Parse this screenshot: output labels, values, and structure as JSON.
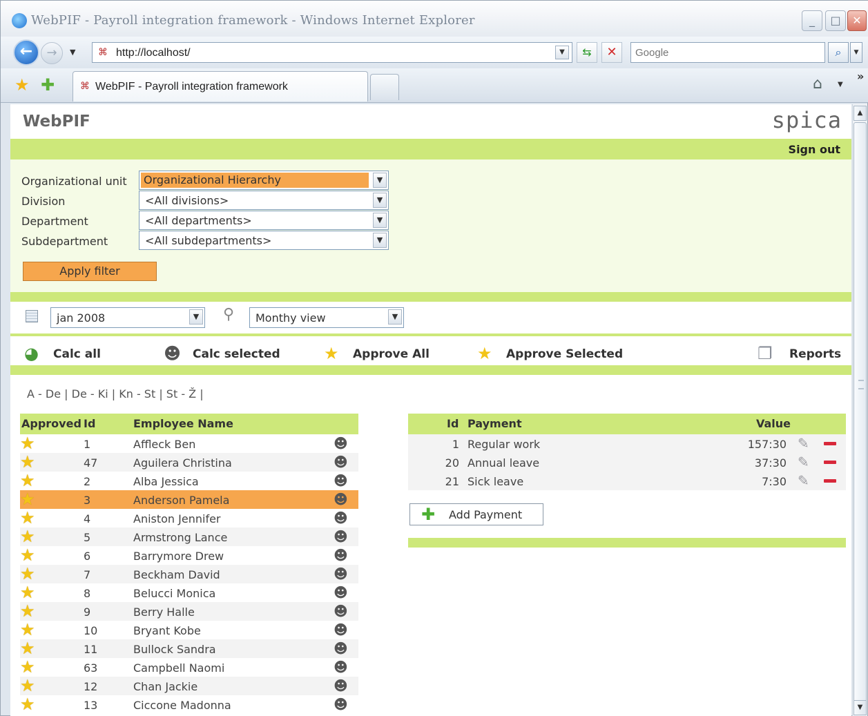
{
  "browser": {
    "window_title": "WebPIF - Payroll integration framework - Windows Internet Explorer",
    "address": "http://localhost/",
    "search_placeholder": "Google",
    "tab_title": "WebPIF - Payroll integration framework"
  },
  "app": {
    "brand": "WebPIF",
    "logo": "spica",
    "sign_out": "Sign out"
  },
  "filter": {
    "org_unit_label": "Organizational unit",
    "org_unit_value": "Organizational Hierarchy",
    "division_label": "Division",
    "division_value": "<All divisions>",
    "department_label": "Department",
    "department_value": "<All departments>",
    "subdepartment_label": "Subdepartment",
    "subdepartment_value": "<All subdepartments>",
    "apply_label": "Apply filter"
  },
  "period": {
    "month_value": "jan 2008",
    "view_value": "Monthy view"
  },
  "actions": {
    "calc_all": "Calc all",
    "calc_selected": "Calc selected",
    "approve_all": "Approve All",
    "approve_selected": "Approve Selected",
    "reports": "Reports"
  },
  "alpha_filter": "A - De | De - Ki | Kn - St | St - Ž |",
  "employees": {
    "headers": {
      "approved": "Approved",
      "id": "Id",
      "name": "Employee Name"
    },
    "selected_index": 3,
    "rows": [
      {
        "id": "1",
        "name": "Affleck Ben"
      },
      {
        "id": "47",
        "name": "Aguilera Christina"
      },
      {
        "id": "2",
        "name": "Alba Jessica"
      },
      {
        "id": "3",
        "name": "Anderson Pamela"
      },
      {
        "id": "4",
        "name": "Aniston Jennifer"
      },
      {
        "id": "5",
        "name": "Armstrong Lance"
      },
      {
        "id": "6",
        "name": "Barrymore Drew"
      },
      {
        "id": "7",
        "name": "Beckham David"
      },
      {
        "id": "8",
        "name": "Belucci Monica"
      },
      {
        "id": "9",
        "name": "Berry Halle"
      },
      {
        "id": "10",
        "name": "Bryant Kobe"
      },
      {
        "id": "11",
        "name": "Bullock Sandra"
      },
      {
        "id": "63",
        "name": "Campbell Naomi"
      },
      {
        "id": "12",
        "name": "Chan Jackie"
      },
      {
        "id": "13",
        "name": "Ciccone Madonna"
      }
    ]
  },
  "payments": {
    "headers": {
      "id": "Id",
      "payment": "Payment",
      "value": "Value"
    },
    "rows": [
      {
        "id": "1",
        "name": "Regular work",
        "value": "157:30"
      },
      {
        "id": "20",
        "name": "Annual leave",
        "value": "37:30"
      },
      {
        "id": "21",
        "name": "Sick leave",
        "value": "7:30"
      }
    ],
    "add_label": "Add Payment"
  },
  "colors": {
    "accent_green": "#cde87a",
    "highlight_orange": "#f6a64d",
    "filter_bg": "#f5fbe6"
  },
  "icons": {
    "approved": "star-icon",
    "calc_row": "calc-person-icon",
    "edit": "pencil-icon",
    "delete": "minus-icon",
    "add": "plus-icon"
  }
}
